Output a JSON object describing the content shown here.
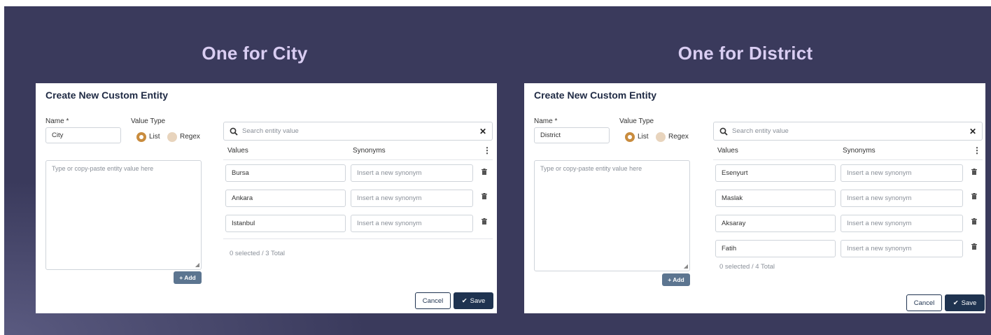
{
  "colors": {
    "background": "#3a3a5c",
    "heading": "#d9cdf2",
    "accent": "#c98c3e",
    "primary": "#1f3350",
    "add_button": "#5c7590"
  },
  "panels": [
    {
      "heading": "One for City",
      "title": "Create New Custom Entity",
      "name_label": "Name *",
      "name_value": "City",
      "value_type_label": "Value Type",
      "option_list": "List",
      "option_regex": "Regex",
      "selected_value_type": "List",
      "textarea_placeholder": "Type or copy-paste entity value here",
      "add_label": "+ Add",
      "search_placeholder": "Search entity value",
      "col_values": "Values",
      "col_synonyms": "Synonyms",
      "synonym_placeholder": "Insert a new synonym",
      "values": [
        "Bursa",
        "Ankara",
        "Istanbul"
      ],
      "status": "0 selected / 3 Total",
      "cancel_label": "Cancel",
      "save_label": "Save"
    },
    {
      "heading": "One for District",
      "title": "Create New Custom Entity",
      "name_label": "Name *",
      "name_value": "District",
      "value_type_label": "Value Type",
      "option_list": "List",
      "option_regex": "Regex",
      "selected_value_type": "List",
      "textarea_placeholder": "Type or copy-paste entity value here",
      "add_label": "+ Add",
      "search_placeholder": "Search entity value",
      "col_values": "Values",
      "col_synonyms": "Synonyms",
      "synonym_placeholder": "Insert a new synonym",
      "values": [
        "Esenyurt",
        "Maslak",
        "Aksaray",
        "Fatih"
      ],
      "status": "0 selected / 4 Total",
      "cancel_label": "Cancel",
      "save_label": "Save"
    }
  ]
}
